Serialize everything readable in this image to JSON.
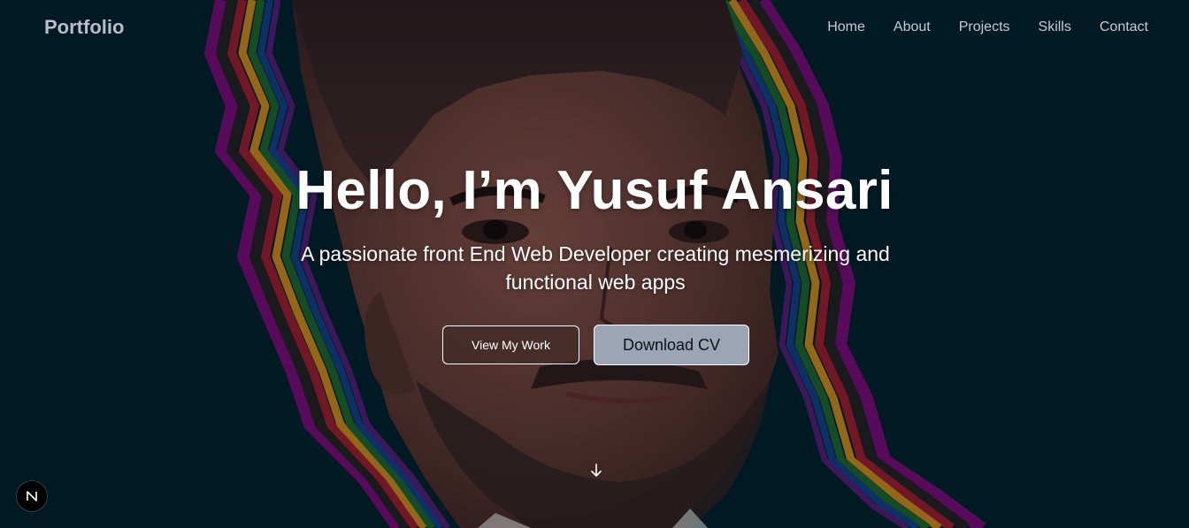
{
  "nav": {
    "brand": "Portfolio",
    "links": [
      "Home",
      "About",
      "Projects",
      "Skills",
      "Contact"
    ]
  },
  "hero": {
    "title": "Hello, I’m Yusuf Ansari",
    "subtitle": "A passionate front End Web Developer creating mesmerizing and functional web apps",
    "primary_button": "View My Work",
    "secondary_button": "Download CV",
    "background_image": "portrait-illustration",
    "scroll_icon": "arrow-down-icon"
  },
  "badge": {
    "icon": "nextjs-logo-icon",
    "letter": "N"
  },
  "colors": {
    "background": "#011e29",
    "accent_button": "#9ca5b3",
    "text": "#ffffff",
    "nav_text": "#c7cbd0"
  }
}
